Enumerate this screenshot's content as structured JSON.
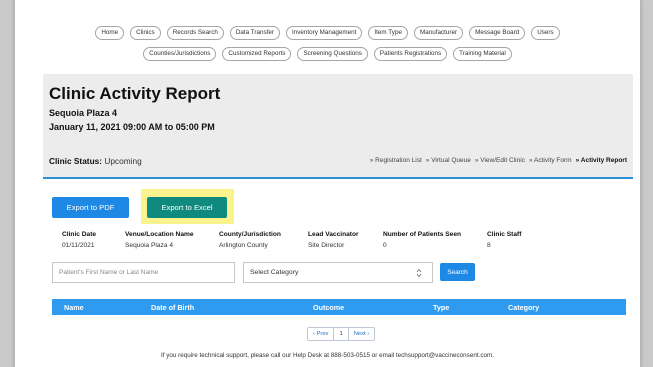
{
  "nav": {
    "row1": [
      "Home",
      "Clinics",
      "Records Search",
      "Data Transfer",
      "Inventory Management",
      "Item Type",
      "Manufacturer",
      "Message Board",
      "Users"
    ],
    "row2": [
      "Counties/Jurisdictions",
      "Customized Reports",
      "Screening Questions",
      "Patients Registrations",
      "Training Material"
    ]
  },
  "header": {
    "title": "Clinic Activity Report",
    "location": "Sequoia Plaza 4",
    "datetime": "January 11, 2021 09:00 AM to 05:00 PM",
    "status_label": "Clinic Status:",
    "status_value": "Upcoming",
    "links": [
      "» Registration List",
      "» Virtual Queue",
      "» View/Edit Clinic",
      "» Activity Form",
      "» Activity Report"
    ]
  },
  "actions": {
    "export_pdf": "Export to PDF",
    "export_excel": "Export to Excel"
  },
  "info": [
    {
      "label": "Clinic Date",
      "value": "01/11/2021"
    },
    {
      "label": "Venue/Location Name",
      "value": "Sequoia Plaza 4"
    },
    {
      "label": "County/Jurisdiction",
      "value": "Arlington County"
    },
    {
      "label": "Lead Vaccinator",
      "value": "Site Director"
    },
    {
      "label": "Number of Patients Seen",
      "value": "0"
    },
    {
      "label": "Clinic Staff",
      "value": "8"
    }
  ],
  "filters": {
    "search_placeholder": "Patient's First Name or Last Name",
    "category_selected": "Select Category",
    "search_button": "Search"
  },
  "table": {
    "columns": [
      "Name",
      "Date of Birth",
      "Outcome",
      "Type",
      "Category"
    ]
  },
  "pagination": {
    "prev": "‹ Prev",
    "current": "1",
    "next": "Next ›"
  },
  "footer": "If you require technical support, please call our Help Desk at 888-503-0515 or email techsupport@vaccineconsent.com.",
  "colors": {
    "primary": "#1e88e5",
    "excel": "#0f8a7e",
    "highlight": "#fbf38e",
    "table_header": "#2f9bf0"
  }
}
